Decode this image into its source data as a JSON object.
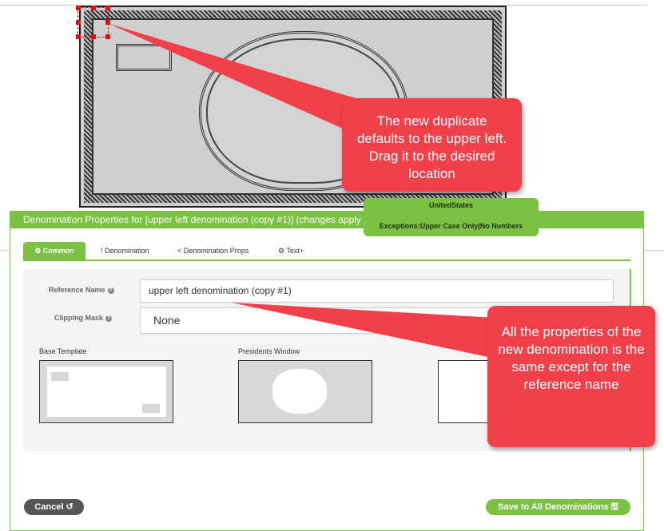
{
  "tooltip": {
    "line1": "UnitedStates",
    "line2": "Exceptions:Upper Case Only|No Numbers"
  },
  "panel": {
    "title": "Denomination Properties for [upper left denomination (copy #1)] (changes apply to All Denominations)",
    "tabs": [
      {
        "icon": "recycle-icon",
        "label": "♻ Common"
      },
      {
        "icon": "exclamation-icon",
        "label": "! Denomination"
      },
      {
        "icon": "share-icon",
        "label": "< Denomination Props"
      },
      {
        "icon": "gears-icon",
        "label": "⚙ Text+"
      }
    ],
    "reference_name_label": "Reference Name",
    "reference_name_value": "upper left denomination (copy #1)",
    "clipping_mask_label": "Clipping Mask",
    "clipping_mask_value": "None",
    "help_icon": "?",
    "base_template_label": "Base Template",
    "presidents_window_label": "Presidents Window",
    "cancel_label": "Cancel ↺",
    "save_label": "Save to All Denominations 🖫"
  },
  "callouts": {
    "top": "The new duplicate defaults to the upper left. Drag it to the desired location",
    "right": "All the properties of the new denomination is the same except for the reference name"
  },
  "colors": {
    "accent": "#7cc242",
    "callout": "#f2404a",
    "cancel": "#555555"
  }
}
